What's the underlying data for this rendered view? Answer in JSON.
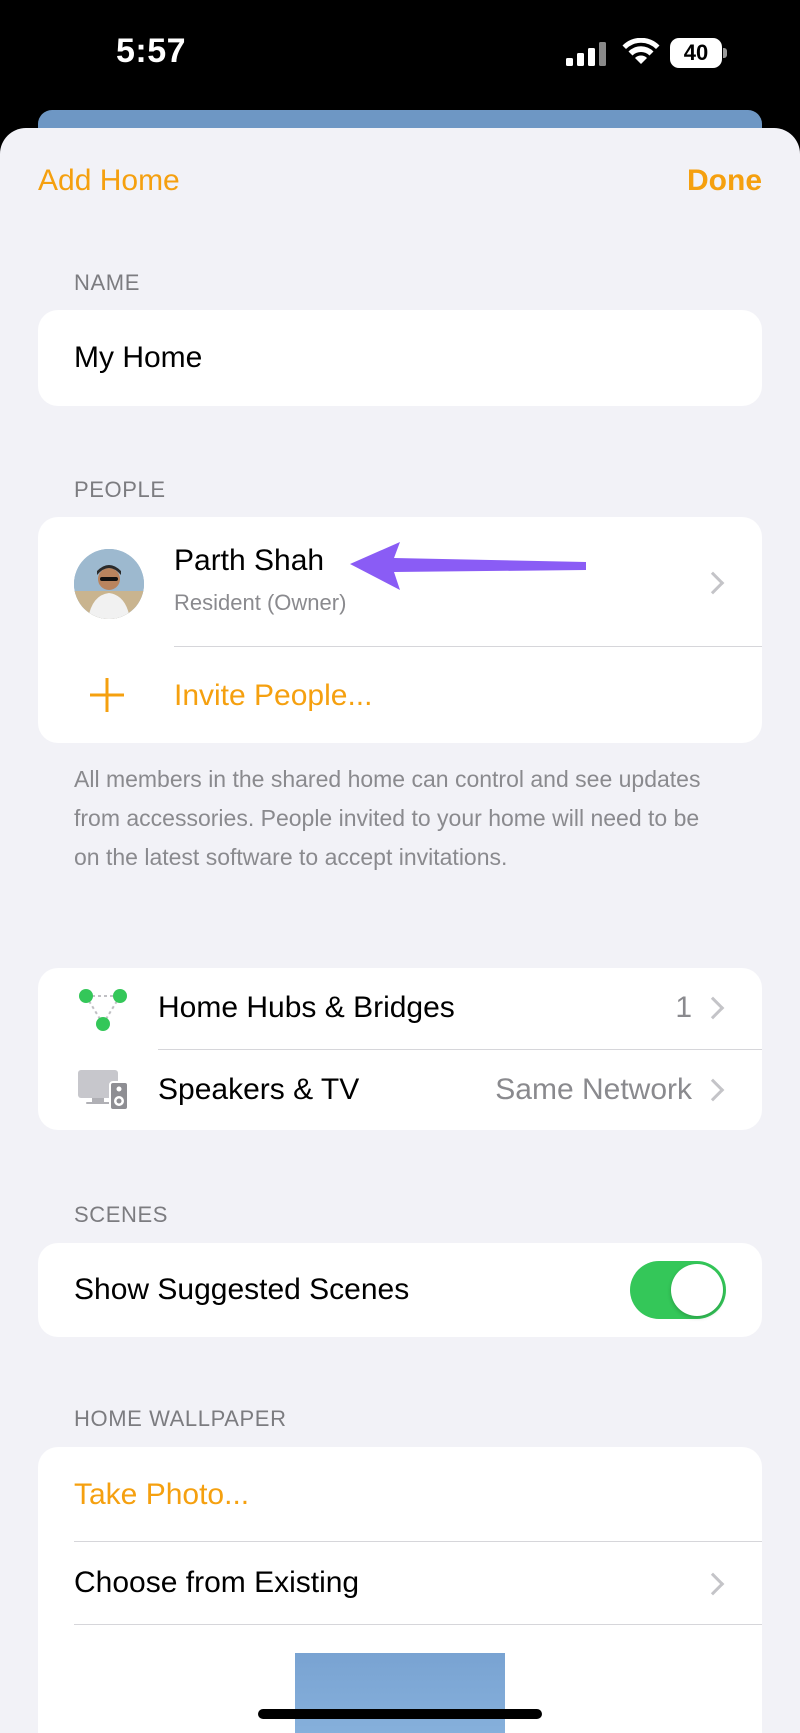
{
  "status_bar": {
    "time": "5:57",
    "battery": "40"
  },
  "nav": {
    "left_label": "Add Home",
    "right_label": "Done"
  },
  "name_section": {
    "header": "NAME",
    "value": "My Home"
  },
  "people_section": {
    "header": "PEOPLE",
    "person": {
      "name": "Parth Shah",
      "role": "Resident (Owner)"
    },
    "invite_label": "Invite People...",
    "footer": "All members in the shared home can control and see updates from accessories. People invited to your home will need to be on the latest software to accept invitations."
  },
  "hubs_section": {
    "rows": [
      {
        "icon": "hub-icon",
        "label": "Home Hubs & Bridges",
        "value": "1"
      },
      {
        "icon": "speaker-tv-icon",
        "label": "Speakers & TV",
        "value": "Same Network"
      }
    ]
  },
  "scenes_section": {
    "header": "SCENES",
    "label": "Show Suggested Scenes",
    "enabled": true
  },
  "wallpaper_section": {
    "header": "HOME WALLPAPER",
    "take_photo_label": "Take Photo...",
    "choose_existing_label": "Choose from Existing"
  },
  "colors": {
    "accent": "#f5a00f",
    "toggle_on": "#34c759",
    "annotation_arrow": "#8a5cf5",
    "background": "#f2f2f7"
  }
}
